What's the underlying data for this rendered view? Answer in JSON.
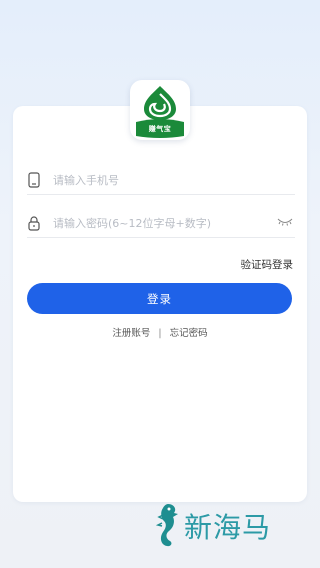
{
  "app": {
    "logo_text": "赚气宝"
  },
  "form": {
    "phone_placeholder": "请输入手机号",
    "password_placeholder": "请输入密码(6~12位字母+数字)",
    "sms_login_label": "验证码登录",
    "login_button_label": "登录",
    "register_label": "注册账号",
    "separator": "|",
    "forgot_password_label": "忘记密码"
  },
  "icons": {
    "phone": "phone-icon",
    "lock": "lock-icon",
    "eye": "eye-closed-icon",
    "seahorse": "seahorse-icon"
  },
  "watermark": {
    "text": "新海马"
  },
  "colors": {
    "primary": "#1f62e8",
    "logo_green": "#1b8a3a",
    "watermark": "#2c9aa6"
  }
}
